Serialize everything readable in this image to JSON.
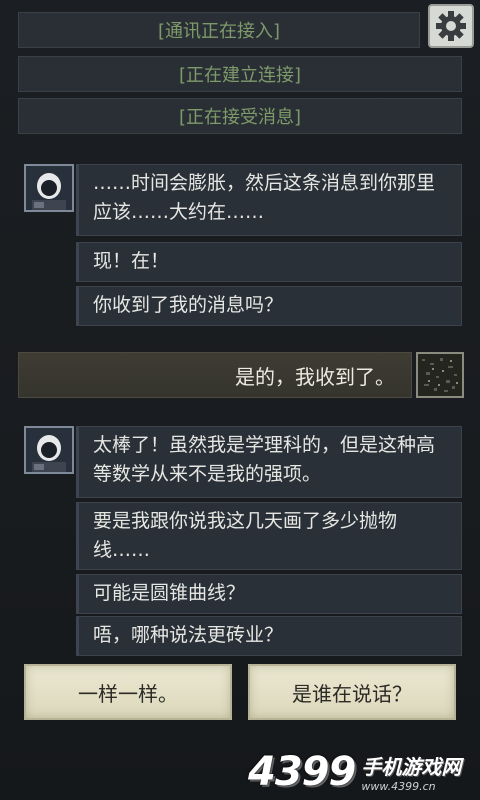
{
  "status_lines": [
    "[通讯正在接入]",
    "[正在建立连接]",
    "[正在接受消息]"
  ],
  "settings_icon": "gear-icon",
  "messages_group1": [
    "……时间会膨胀，然后这条消息到你那里应该……大约在……",
    "现！在！",
    "你收到了我的消息吗？"
  ],
  "player_reply": "是的，我收到了。",
  "messages_group2": [
    "太棒了！虽然我是学理科的，但是这种高等数学从来不是我的强项。",
    "要是我跟你说我这几天画了多少抛物线……",
    "可能是圆锥曲线？",
    "唔，哪种说法更砖业？"
  ],
  "choices": [
    "一样一样。",
    "是谁在说话？"
  ],
  "watermark": {
    "logo": "4399",
    "name": "手机游戏网",
    "url": "www.4399.cn"
  },
  "colors": {
    "status_text": "#7d9a6a",
    "bubble_bg": "#2a3038",
    "choice_bg": "#e4e0c6",
    "reply_bg": "#3a382f"
  }
}
